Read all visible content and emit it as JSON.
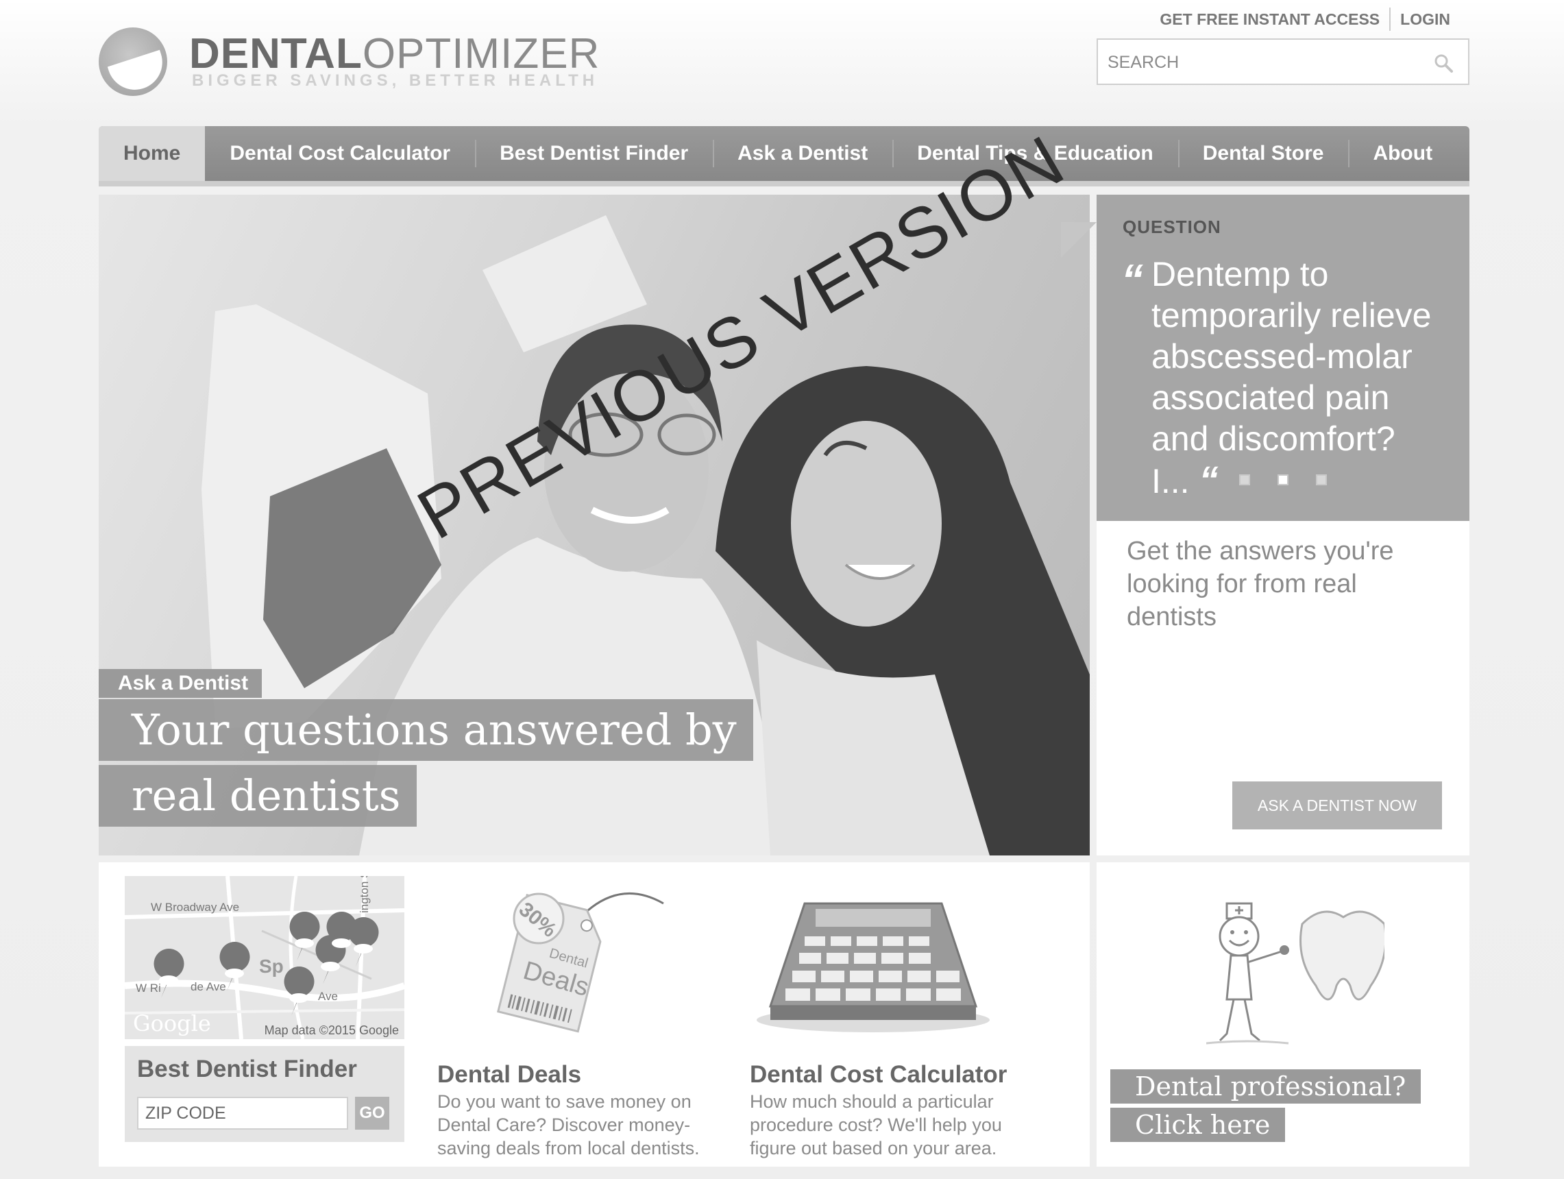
{
  "brand": {
    "name_bold": "DENTAL",
    "name_light": "OPTIMIZER",
    "tagline": "BIGGER SAVINGS, BETTER HEALTH"
  },
  "header": {
    "links": [
      "GET FREE INSTANT ACCESS",
      "LOGIN"
    ],
    "search_placeholder": "SEARCH"
  },
  "nav": {
    "items": [
      "Home",
      "Dental Cost Calculator",
      "Best Dentist Finder",
      "Ask a Dentist",
      "Dental Tips & Education",
      "Dental Store",
      "About"
    ],
    "active": "Home"
  },
  "hero": {
    "eyebrow": "Ask a Dentist",
    "headline_line1": "Your questions answered by",
    "headline_line2": "real dentists",
    "watermark": "PREVIOUS VERSION"
  },
  "question": {
    "label": "QUESTION",
    "open_quote": "“",
    "text": "Dentemp to temporarily relieve abscessed-molar associated pain and discomfort? I...",
    "close_quote": "“",
    "slides": 3,
    "active_slide": 2,
    "subtext": "Get the answers you're looking for from real dentists",
    "button": "ASK A DENTIST NOW"
  },
  "finder": {
    "map_roads": [
      "W Broadway Ave",
      "W Ri",
      "de Ave",
      "Ave",
      "ington St",
      "Sp"
    ],
    "map_credit": "Map data ©2015 Google",
    "map_logo": "Google",
    "title": "Best Dentist Finder",
    "zip_placeholder": "ZIP CODE",
    "go": "GO"
  },
  "deals": {
    "tag_percent": "30%",
    "tag_label_small": "Dental",
    "tag_label_big": "Deals",
    "title": "Dental Deals",
    "description": "Do you want to save money on Dental Care? Discover money-saving deals from local dentists."
  },
  "calculator": {
    "title": "Dental Cost Calculator",
    "description": "How much should a particular procedure cost? We'll help you figure out based on your area."
  },
  "professional": {
    "line1": "Dental professional?",
    "line2": "Click here"
  }
}
